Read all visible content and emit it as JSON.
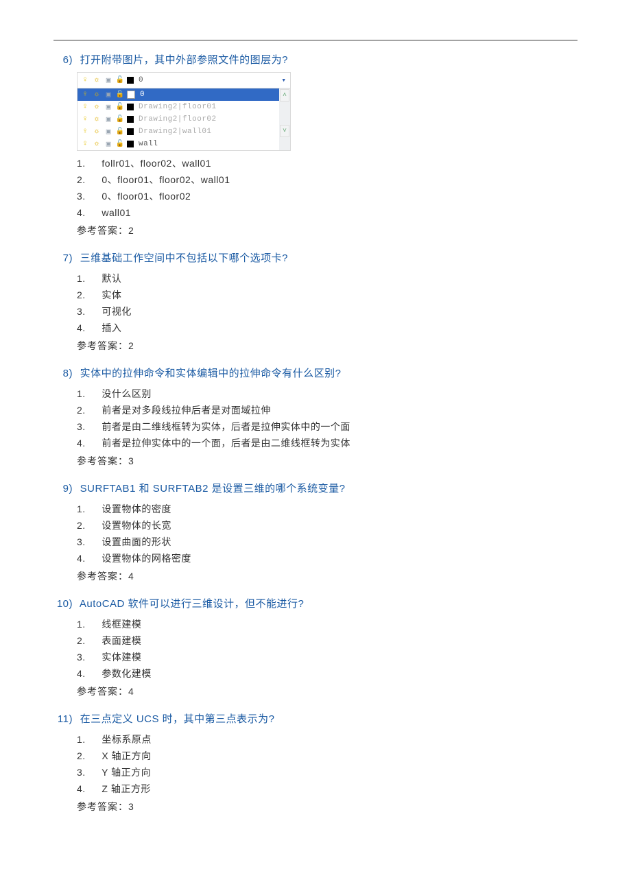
{
  "answer_label_prefix": "参考答案：",
  "questions": [
    {
      "num": "6)",
      "title": "打开附带图片，其中外部参照文件的图层为?",
      "has_layer_img": true,
      "options": [
        "follr01、floor02、wall01",
        "0、floor01、floor02、wall01",
        "0、floor01、floor02",
        "wall01"
      ],
      "answer": "2"
    },
    {
      "num": "7)",
      "title": "三维基础工作空间中不包括以下哪个选项卡?",
      "options": [
        "默认",
        "实体",
        "可视化",
        "插入"
      ],
      "answer": "2"
    },
    {
      "num": "8)",
      "title": "实体中的拉伸命令和实体编辑中的拉伸命令有什么区别?",
      "options": [
        "没什么区别",
        "前者是对多段线拉伸后者是对面域拉伸",
        "前者是由二维线框转为实体，后者是拉伸实体中的一个面",
        "前者是拉伸实体中的一个面，后者是由二维线框转为实体"
      ],
      "answer": "3"
    },
    {
      "num": "9)",
      "title": "SURFTAB1 和 SURFTAB2 是设置三维的哪个系统变量?",
      "options": [
        "设置物体的密度",
        "设置物体的长宽",
        "设置曲面的形状",
        "设置物体的网格密度"
      ],
      "answer": "4"
    },
    {
      "num": "10)",
      "title": "AutoCAD 软件可以进行三维设计，但不能进行?",
      "options": [
        "线框建模",
        "表面建模",
        "实体建模",
        "参数化建模"
      ],
      "answer": "4"
    },
    {
      "num": "11)",
      "title": "在三点定义 UCS 时，其中第三点表示为?",
      "options": [
        "坐标系原点",
        "X 轴正方向",
        "Y 轴正方向",
        "Z 轴正方形"
      ],
      "answer": "3"
    }
  ],
  "layer_dropdown": {
    "header_name": "0",
    "rows": [
      {
        "name": "0",
        "selected": true
      },
      {
        "name": "Drawing2|floor01",
        "selected": false,
        "dim": true
      },
      {
        "name": "Drawing2|floor02",
        "selected": false,
        "dim": true
      },
      {
        "name": "Drawing2|wall01",
        "selected": false,
        "dim": true
      },
      {
        "name": "wall",
        "selected": false
      }
    ]
  }
}
